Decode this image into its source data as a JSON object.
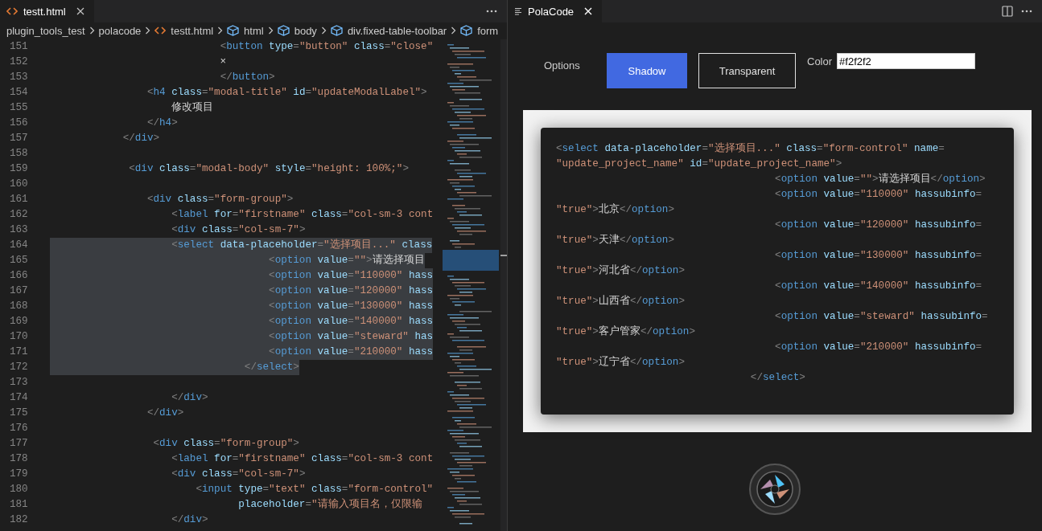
{
  "editor": {
    "tab": {
      "label": "testt.html",
      "selected": true
    },
    "breadcrumb": [
      {
        "kind": "folder",
        "label": "plugin_tools_test"
      },
      {
        "kind": "folder",
        "label": "polacode"
      },
      {
        "kind": "file",
        "label": "testt.html"
      },
      {
        "kind": "element",
        "label": "html"
      },
      {
        "kind": "element",
        "label": "body"
      },
      {
        "kind": "element",
        "label": "div.fixed-table-toolbar"
      },
      {
        "kind": "element",
        "label": "form"
      }
    ],
    "lines": [
      {
        "number": "151",
        "selected": false,
        "code": "                            <button type=\"button\" class=\"close\""
      },
      {
        "number": "152",
        "selected": false,
        "code": "                            ×"
      },
      {
        "number": "153",
        "selected": false,
        "code": "                            </button>"
      },
      {
        "number": "154",
        "selected": false,
        "code": "                <h4 class=\"modal-title\" id=\"updateModalLabel\">"
      },
      {
        "number": "155",
        "selected": false,
        "code": "                    修改项目"
      },
      {
        "number": "156",
        "selected": false,
        "code": "                </h4>"
      },
      {
        "number": "157",
        "selected": false,
        "code": "            </div>"
      },
      {
        "number": "158",
        "selected": false
      },
      {
        "number": "159",
        "selected": false,
        "code": "             <div class=\"modal-body\" style=\"height: 100%;\">"
      },
      {
        "number": "160",
        "selected": false
      },
      {
        "number": "161",
        "selected": false,
        "code": "                <div class=\"form-group\">"
      },
      {
        "number": "162",
        "selected": false,
        "code": "                    <label for=\"firstname\" class=\"col-sm-3 cont"
      },
      {
        "number": "163",
        "selected": false,
        "code": "                    <div class=\"col-sm-7\">"
      },
      {
        "number": "164",
        "selected": true,
        "code": "                    <select data-placeholder=\"选择项目...\" class"
      },
      {
        "number": "165",
        "selected": true,
        "code": "                                    <option value=\"\">请选择项目"
      },
      {
        "number": "166",
        "selected": true,
        "code": "                                    <option value=\"110000\" hass"
      },
      {
        "number": "167",
        "selected": true,
        "code": "                                    <option value=\"120000\" hass"
      },
      {
        "number": "168",
        "selected": true,
        "code": "                                    <option value=\"130000\" hass"
      },
      {
        "number": "169",
        "selected": true,
        "code": "                                    <option value=\"140000\" hass"
      },
      {
        "number": "170",
        "selected": true,
        "code": "                                    <option value=\"steward\" has"
      },
      {
        "number": "171",
        "selected": true,
        "code": "                                    <option value=\"210000\" hass"
      },
      {
        "number": "172",
        "selected": true,
        "code": "                                </select>"
      },
      {
        "number": "173",
        "selected": false
      },
      {
        "number": "174",
        "selected": false,
        "code": "                    </div>"
      },
      {
        "number": "175",
        "selected": false,
        "code": "                </div>"
      },
      {
        "number": "176",
        "selected": false
      },
      {
        "number": "177",
        "selected": false,
        "code": "                 <div class=\"form-group\">"
      },
      {
        "number": "178",
        "selected": false,
        "code": "                    <label for=\"firstname\" class=\"col-sm-3 cont"
      },
      {
        "number": "179",
        "selected": false,
        "code": "                    <div class=\"col-sm-7\">"
      },
      {
        "number": "180",
        "selected": false,
        "code": "                        <input type=\"text\" class=\"form-control\""
      },
      {
        "number": "181",
        "selected": false,
        "code": "                               placeholder=\"请输入项目名，仅限输"
      },
      {
        "number": "182",
        "selected": false,
        "code": "                    </div>"
      }
    ]
  },
  "panel": {
    "tab": {
      "label": "PolaCode",
      "selected": true
    },
    "options_label": "Options",
    "modes": [
      {
        "kind": "shadow",
        "label": "Shadow",
        "selected": true
      },
      {
        "kind": "transparent",
        "label": "Transparent",
        "selected": false
      }
    ],
    "color_label": "Color",
    "color_value": "#f2f2f2",
    "snippet": [
      "<select data-placeholder=\"选择项目...\" class=\"form-control\" name=",
      "\"update_project_name\" id=\"update_project_name\">",
      "                                    <option value=\"\">请选择项目</option>",
      "                                    <option value=\"110000\" hassubinfo=",
      "\"true\">北京</option>",
      "                                    <option value=\"120000\" hassubinfo=",
      "\"true\">天津</option>",
      "                                    <option value=\"130000\" hassubinfo=",
      "\"true\">河北省</option>",
      "                                    <option value=\"140000\" hassubinfo=",
      "\"true\">山西省</option>",
      "                                    <option value=\"steward\" hassubinfo=",
      "\"true\">客户管家</option>",
      "                                    <option value=\"210000\" hassubinfo=",
      "\"true\">辽宁省</option>",
      "                                </select>"
    ]
  }
}
